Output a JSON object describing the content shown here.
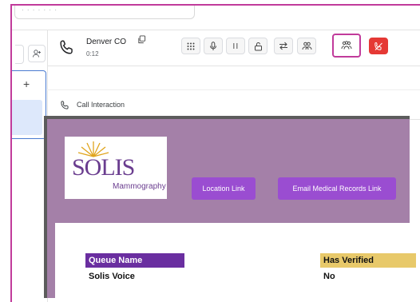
{
  "search": {
    "text": "· · · ·  · ·  ·"
  },
  "call": {
    "caller_name": "Denver CO",
    "timer": "0:12"
  },
  "interaction": {
    "label": "Call Interaction"
  },
  "embedded": {
    "logo": {
      "main_text": "SOLIS",
      "sub_text": "Mammography"
    },
    "buttons": [
      "Location Link",
      "Email Medical Records Link"
    ],
    "table": {
      "col1_header": "Queue Name",
      "col1_value": "Solis Voice",
      "col2_header": "Has Verified",
      "col2_value": "No"
    }
  },
  "colors": {
    "highlight": "#c13b9b",
    "end_call": "#e53935",
    "embed_bg": "#a480a8",
    "button": "#9a4dd1",
    "queue_header": "#6a2ea0",
    "verified_header": "#e8c96a"
  }
}
